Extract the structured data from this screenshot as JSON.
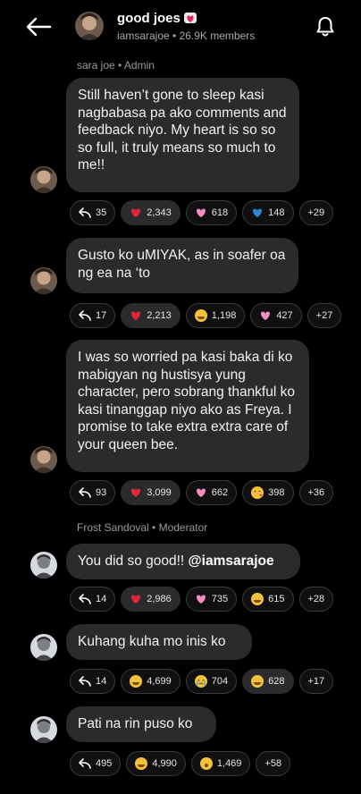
{
  "header": {
    "title": "good joes",
    "subtitle": "iamsarajoe • 26.9K members"
  },
  "sections": [
    {
      "label": "sara joe • Admin"
    },
    {
      "label": "Frost Sandoval • Moderator"
    }
  ],
  "messages": [
    {
      "text": "Still haven’t gone to sleep kasi nagbabasa pa ako comments and feedback niyo. My heart is so so so full, it truly means so much to me!!",
      "reply_count": "35",
      "reactions": [
        {
          "emoji": "red-heart",
          "count": "2,343",
          "selected": true
        },
        {
          "emoji": "pink-heart",
          "count": "618"
        },
        {
          "emoji": "blue-heart",
          "count": "148"
        }
      ],
      "more": "+29"
    },
    {
      "text": "Gusto ko uMIYAK, as in soafer oa ng ea na ‘to",
      "reply_count": "17",
      "reactions": [
        {
          "emoji": "red-heart",
          "count": "2,213",
          "selected": true
        },
        {
          "emoji": "grin-face",
          "count": "1,198"
        },
        {
          "emoji": "pink-heart",
          "count": "427"
        }
      ],
      "more": "+27"
    },
    {
      "text": "I was so worried pa kasi baka di ko mabigyan ng hustisya yung character, pero sobrang thankful ko kasi tinanggap niyo ako as Freya. I promise to take extra extra care of your queen bee.",
      "reply_count": "93",
      "reactions": [
        {
          "emoji": "red-heart",
          "count": "3,099",
          "selected": true
        },
        {
          "emoji": "pink-heart",
          "count": "662"
        },
        {
          "emoji": "kiss-face",
          "count": "398"
        }
      ],
      "more": "+36"
    },
    {
      "text_prefix": "You did so good!! ",
      "mention": "@iamsarajoe",
      "reply_count": "14",
      "reactions": [
        {
          "emoji": "red-heart",
          "count": "2,986",
          "selected": true
        },
        {
          "emoji": "pink-heart",
          "count": "735"
        },
        {
          "emoji": "grin-face",
          "count": "615"
        }
      ],
      "more": "+28"
    },
    {
      "text": "Kuhang kuha mo inis ko",
      "reply_count": "14",
      "reactions": [
        {
          "emoji": "laugh-face",
          "count": "4,699"
        },
        {
          "emoji": "cry-face",
          "count": "704"
        },
        {
          "emoji": "grin-face",
          "count": "628",
          "selected": true
        }
      ],
      "more": "+17"
    },
    {
      "text": "Pati na rin puso ko",
      "reply_count": "495",
      "reactions": [
        {
          "emoji": "laugh-face",
          "count": "4,990"
        },
        {
          "emoji": "surprised-face",
          "count": "1,469"
        }
      ],
      "more": "+58"
    }
  ]
}
